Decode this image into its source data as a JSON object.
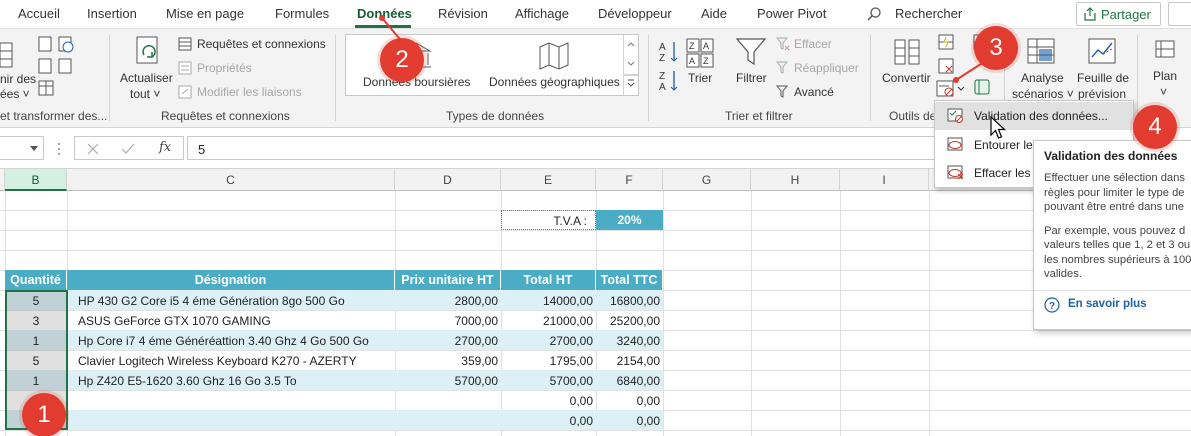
{
  "menu": {
    "tabs": [
      "Accueil",
      "Insertion",
      "Mise en page",
      "Formules",
      "Données",
      "Révision",
      "Affichage",
      "Développeur",
      "Aide",
      "Power Pivot"
    ],
    "active_tab": "Données",
    "search_label": "Rechercher",
    "share_label": "Partager"
  },
  "ribbon": {
    "get_transform": {
      "btn1_line1": "nir des",
      "btn1_line2": "ées ˅",
      "group_label": "et transformer des..."
    },
    "queries": {
      "refresh_line1": "Actualiser",
      "refresh_line2": "tout ˅",
      "queries_connections": "Requêtes et connexions",
      "properties": "Propriétés",
      "edit_links": "Modifier les liaisons",
      "group_label": "Requêtes et connexions"
    },
    "data_types": {
      "stocks": "Données boursières",
      "geography": "Données géographiques",
      "group_label": "Types de données"
    },
    "sort_filter": {
      "sort": "Trier",
      "filter": "Filtrer",
      "clear": "Effacer",
      "reapply": "Réappliquer",
      "advanced": "Avancé",
      "group_label": "Trier et filtrer"
    },
    "data_tools": {
      "convert": "Convertir",
      "group_label": "Outils de"
    },
    "forecast": {
      "whatif_line1": "Analyse",
      "whatif_line2": "scénarios ˅",
      "sheet_line1": "Feuille de",
      "sheet_line2": "prévision"
    },
    "outline": {
      "label": "Plan",
      "caret": "˅"
    }
  },
  "formula_bar": {
    "fx": "fx",
    "value": "5"
  },
  "sheet": {
    "columns": [
      "B",
      "C",
      "D",
      "E",
      "F",
      "G",
      "H",
      "I"
    ],
    "tva_label": "T.V.A :",
    "tva_value": "20%",
    "headers": [
      "Quantité",
      "Désignation",
      "Prix unitaire HT",
      "Total HT",
      "Total TTC"
    ],
    "rows": [
      {
        "qty": "5",
        "designation": "HP 430 G2 Core i5 4 éme Génération 8go 500 Go",
        "pu": "2800,00",
        "ht": "14000,00",
        "ttc": "16800,00"
      },
      {
        "qty": "3",
        "designation": "ASUS GeForce GTX 1070 GAMING",
        "pu": "7000,00",
        "ht": "21000,00",
        "ttc": "25200,00"
      },
      {
        "qty": "1",
        "designation": "Hp Core i7 4 éme Généréattion 3.40 Ghz 4 Go 500 Go",
        "pu": "2700,00",
        "ht": "2700,00",
        "ttc": "3240,00"
      },
      {
        "qty": "5",
        "designation": "Clavier Logitech Wireless Keyboard K270 - AZERTY",
        "pu": "359,00",
        "ht": "1795,00",
        "ttc": "2154,00"
      },
      {
        "qty": "1",
        "designation": "Hp Z420 E5-1620 3.60 Ghz 16 Go 3.5 To",
        "pu": "5700,00",
        "ht": "5700,00",
        "ttc": "6840,00"
      },
      {
        "qty": "",
        "designation": "",
        "pu": "",
        "ht": "0,00",
        "ttc": "0,00"
      },
      {
        "qty": "",
        "designation": "",
        "pu": "",
        "ht": "0,00",
        "ttc": "0,00"
      }
    ]
  },
  "dropdown": {
    "items": [
      "Validation des données...",
      "Entourer les",
      "Effacer les c"
    ]
  },
  "tooltip": {
    "title": "Validation des données",
    "para1": [
      "Effectuer une sélection dans",
      "règles pour limiter le type de",
      "pouvant être entré dans une"
    ],
    "para2": [
      "Par exemple, vous pouvez d",
      "valeurs telles que 1, 2 et 3 ou",
      "les nombres supérieurs à 100",
      "valides."
    ],
    "link": "En savoir plus"
  },
  "badges": [
    "1",
    "2",
    "3",
    "4"
  ],
  "colors": {
    "excel_green": "#217346",
    "table_header": "#4bacc6",
    "row_band": "#dcf0f5",
    "badge_red": "#e23b2f"
  }
}
